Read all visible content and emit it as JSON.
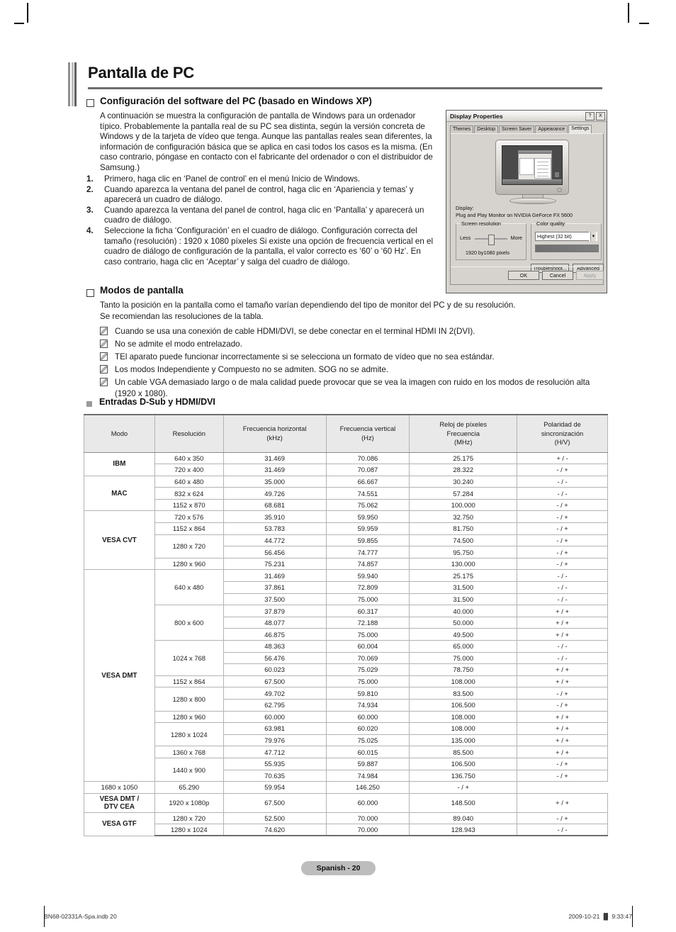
{
  "title": "Pantalla de PC",
  "section1": {
    "heading": "Configuración del software del PC (basado en Windows XP)",
    "intro": "A continuación se muestra la configuración de pantalla de Windows para un ordenador típico. Probablemente la pantalla real de su PC sea distinta, según la versión concreta de Windows y de la tarjeta de vídeo que tenga. Aunque las pantallas reales sean diferentes, la información de configuración básica que se aplica en casi todos los casos es la misma. (En caso contrario, póngase en contacto con el fabricante del ordenador o con el distribuidor de Samsung.)",
    "steps": [
      {
        "num": "1.",
        "text": "Primero, haga clic en ‘Panel de control’ en el menú Inicio de Windows."
      },
      {
        "num": "2.",
        "text": "Cuando aparezca la ventana del panel de control, haga clic en ‘Apariencia y temas’ y aparecerá un cuadro de diálogo."
      },
      {
        "num": "3.",
        "text": "Cuando aparezca la ventana del panel de control, haga clic en ‘Pantalla’ y aparecerá un cuadro de diálogo."
      },
      {
        "num": "4.",
        "text": "Seleccione la ficha ‘Configuración’ en el cuadro de diálogo. Configuración correcta del tamaño (resolución) : 1920 x 1080 píxeles Si existe una opción de frecuencia vertical en el cuadro de diálogo de configuración de la pantalla, el valor correcto es ‘60’ o ‘60 Hz’. En caso contrario, haga clic en ‘Aceptar’ y salga del cuadro de diálogo."
      }
    ]
  },
  "dialog": {
    "title": "Display Properties",
    "help_button": "?",
    "close_button": "X",
    "tabs": [
      "Themes",
      "Desktop",
      "Screen Saver",
      "Appearance",
      "Settings"
    ],
    "active_tab": "Settings",
    "display_label": "Display:",
    "display_value": "Plug and Play Monitor on NVIDIA GeForce FX 5600",
    "screen_resolution_legend": "Screen resolution",
    "less_label": "Less",
    "more_label": "More",
    "resolution_value": "1920 by1080 pixels",
    "color_quality_legend": "Color quality",
    "color_quality_value": "Highest (32 bit)",
    "troubleshoot_button": "Troubleshoot...",
    "advanced_button": "Advanced",
    "ok_button": "OK",
    "cancel_button": "Cancel",
    "apply_button": "Apply"
  },
  "section2": {
    "heading": "Modos de pantalla",
    "p1": "Tanto la posición en la pantalla como el tamaño varían dependiendo del tipo de monitor del PC y de su resolución.",
    "p2": "Se recomiendan las resoluciones de la tabla.",
    "notes": [
      "Cuando se usa una conexión de cable HDMI/DVI, se debe conectar en el terminal HDMI IN 2(DVI).",
      "No se admite el modo entrelazado.",
      "TEl aparato puede funcionar incorrectamente si se selecciona un formato de vídeo que no sea estándar.",
      "Los modos Independiente y Compuesto no se admiten. SOG no se admite.",
      "Un cable VGA demasiado largo o de mala calidad puede provocar que se vea la imagen con ruido en los modos de resolución alta (1920 x 1080)."
    ]
  },
  "table_section": {
    "heading": "Entradas D-Sub y HDMI/DVI",
    "headers": [
      "Modo",
      "Resolución",
      "Frecuencia horizontal\n(kHz)",
      "Frecuencia vertical\n(Hz)",
      "Reloj de píxeles\nFrecuencia\n(MHz)",
      "Polaridad de\nsincronización\n(H/V)"
    ],
    "headers_parts": [
      [
        "Modo"
      ],
      [
        "Resolución"
      ],
      [
        "Frecuencia horizontal",
        "(kHz)"
      ],
      [
        "Frecuencia vertical",
        "(Hz)"
      ],
      [
        "Reloj de píxeles",
        "Frecuencia",
        "(MHz)"
      ],
      [
        "Polaridad de",
        "sincronización",
        "(H/V)"
      ]
    ],
    "rows": [
      {
        "mode": "IBM",
        "mode_span": 2,
        "res": "640 x 350",
        "res_span": 1,
        "h": "31.469",
        "v": "70.086",
        "clk": "25.175",
        "pol": "+ / -"
      },
      {
        "mode": null,
        "res": "720 x 400",
        "res_span": 1,
        "h": "31.469",
        "v": "70.087",
        "clk": "28.322",
        "pol": "- / +"
      },
      {
        "mode": "MAC",
        "mode_span": 3,
        "res": "640 x 480",
        "res_span": 1,
        "h": "35.000",
        "v": "66.667",
        "clk": "30.240",
        "pol": "- / -"
      },
      {
        "mode": null,
        "res": "832 x 624",
        "res_span": 1,
        "h": "49.726",
        "v": "74.551",
        "clk": "57.284",
        "pol": "- / -"
      },
      {
        "mode": null,
        "res": "1152 x 870",
        "res_span": 1,
        "h": "68.681",
        "v": "75.062",
        "clk": "100.000",
        "pol": "- / +"
      },
      {
        "mode": "VESA CVT",
        "mode_span": 5,
        "res": "720 x 576",
        "res_span": 1,
        "h": "35.910",
        "v": "59.950",
        "clk": "32.750",
        "pol": "- / +"
      },
      {
        "mode": null,
        "res": "1152 x 864",
        "res_span": 1,
        "h": "53.783",
        "v": "59.959",
        "clk": "81.750",
        "pol": "- / +"
      },
      {
        "mode": null,
        "res": "1280 x 720",
        "res_span": 2,
        "h": "44.772",
        "v": "59.855",
        "clk": "74.500",
        "pol": "- / +"
      },
      {
        "mode": null,
        "res": null,
        "h": "56.456",
        "v": "74.777",
        "clk": "95.750",
        "pol": "- / +"
      },
      {
        "mode": null,
        "res": "1280 x 960",
        "res_span": 1,
        "h": "75.231",
        "v": "74.857",
        "clk": "130.000",
        "pol": "- / +"
      },
      {
        "mode": "VESA DMT",
        "mode_span": 18,
        "res": "640 x 480",
        "res_span": 3,
        "h": "31.469",
        "v": "59.940",
        "clk": "25.175",
        "pol": "- / -"
      },
      {
        "mode": null,
        "res": null,
        "h": "37.861",
        "v": "72.809",
        "clk": "31.500",
        "pol": "- / -"
      },
      {
        "mode": null,
        "res": null,
        "h": "37.500",
        "v": "75.000",
        "clk": "31.500",
        "pol": "- / -"
      },
      {
        "mode": null,
        "res": "800 x 600",
        "res_span": 3,
        "h": "37.879",
        "v": "60.317",
        "clk": "40.000",
        "pol": "+ / +"
      },
      {
        "mode": null,
        "res": null,
        "h": "48.077",
        "v": "72.188",
        "clk": "50.000",
        "pol": "+ / +"
      },
      {
        "mode": null,
        "res": null,
        "h": "46.875",
        "v": "75.000",
        "clk": "49.500",
        "pol": "+ / +"
      },
      {
        "mode": null,
        "res": "1024 x 768",
        "res_span": 3,
        "h": "48.363",
        "v": "60.004",
        "clk": "65.000",
        "pol": "- / -"
      },
      {
        "mode": null,
        "res": null,
        "h": "56.476",
        "v": "70.069",
        "clk": "75.000",
        "pol": "- / -"
      },
      {
        "mode": null,
        "res": null,
        "h": "60.023",
        "v": "75.029",
        "clk": "78.750",
        "pol": "+ / +"
      },
      {
        "mode": null,
        "res": "1152 x 864",
        "res_span": 1,
        "h": "67.500",
        "v": "75.000",
        "clk": "108.000",
        "pol": "+ / +"
      },
      {
        "mode": null,
        "res": "1280 x 800",
        "res_span": 2,
        "h": "49.702",
        "v": "59.810",
        "clk": "83.500",
        "pol": "- / +"
      },
      {
        "mode": null,
        "res": null,
        "h": "62.795",
        "v": "74.934",
        "clk": "106.500",
        "pol": "- / +"
      },
      {
        "mode": null,
        "res": "1280 x 960",
        "res_span": 1,
        "h": "60.000",
        "v": "60.000",
        "clk": "108.000",
        "pol": "+ / +"
      },
      {
        "mode": null,
        "res": "1280 x 1024",
        "res_span": 2,
        "h": "63.981",
        "v": "60.020",
        "clk": "108.000",
        "pol": "+ / +"
      },
      {
        "mode": null,
        "res": null,
        "h": "79.976",
        "v": "75.025",
        "clk": "135.000",
        "pol": "+ / +"
      },
      {
        "mode": null,
        "res": "1360 x 768",
        "res_span": 1,
        "h": "47.712",
        "v": "60.015",
        "clk": "85.500",
        "pol": "+ / +"
      },
      {
        "mode": null,
        "res": "1440 x 900",
        "res_span": 2,
        "h": "55.935",
        "v": "59.887",
        "clk": "106.500",
        "pol": "- / +"
      },
      {
        "mode": null,
        "res": null,
        "h": "70.635",
        "v": "74.984",
        "clk": "136.750",
        "pol": "- / +"
      },
      {
        "mode": null,
        "res": "1680 x 1050",
        "res_span": 1,
        "h": "65.290",
        "v": "59.954",
        "clk": "146.250",
        "pol": "- / +"
      },
      {
        "mode": "VESA DMT /\nDTV CEA",
        "mode_span": 1,
        "res": "1920 x 1080p",
        "res_span": 1,
        "h": "67.500",
        "v": "60.000",
        "clk": "148.500",
        "pol": "+ / +"
      },
      {
        "mode": "VESA GTF",
        "mode_span": 2,
        "res": "1280 x 720",
        "res_span": 1,
        "h": "52.500",
        "v": "70.000",
        "clk": "89.040",
        "pol": "- / +"
      },
      {
        "mode": null,
        "res": "1280 x 1024",
        "res_span": 1,
        "h": "74.620",
        "v": "70.000",
        "clk": "128.943",
        "pol": "- / -"
      }
    ]
  },
  "footer": {
    "page_badge": "Spanish - 20",
    "file_note": "BN68-02331A-Spa.indb   20",
    "timestamp": "2009-10-21   ▐▌ 9:33:47"
  }
}
